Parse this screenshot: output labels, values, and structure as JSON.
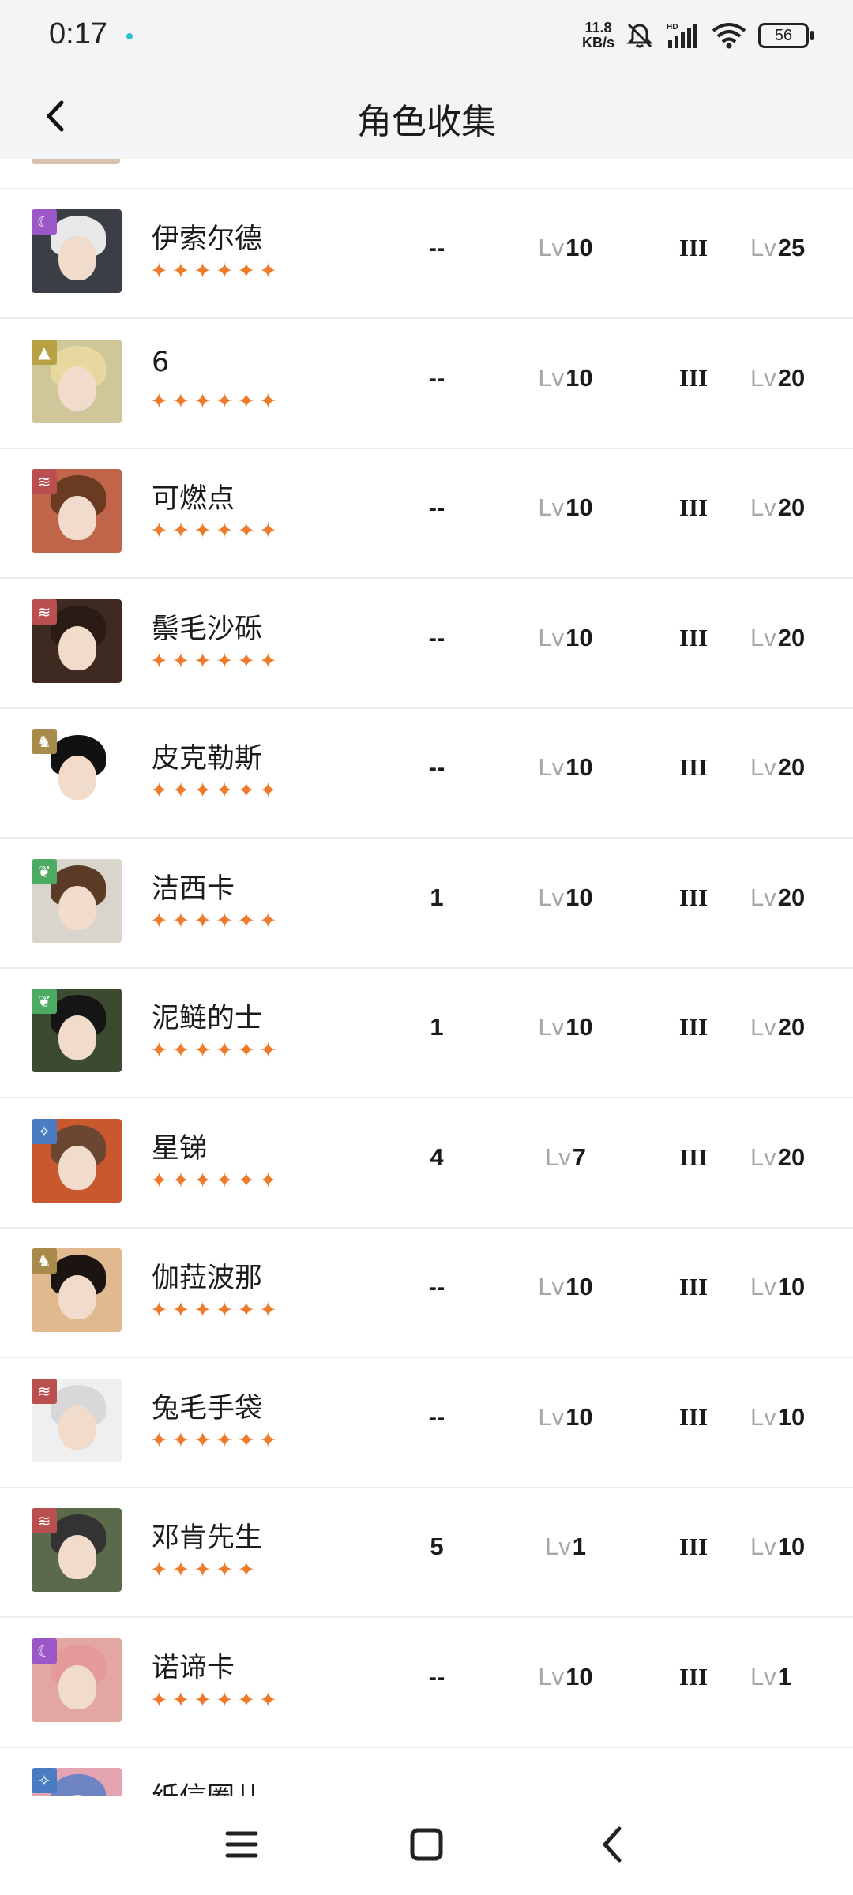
{
  "status": {
    "time": "0:17",
    "net_speed_value": "11.8",
    "net_speed_unit": "KB/s",
    "battery": "56",
    "icons": [
      "bell-muted-icon",
      "hd-signal-icon",
      "wifi-icon",
      "battery-icon"
    ]
  },
  "header": {
    "title": "角色收集"
  },
  "colors": {
    "star": "#ee7b2b",
    "divider": "#ececec",
    "lv_label": "#a7a7a7"
  },
  "characters": [
    {
      "name": "伊索尔德",
      "element": "moon",
      "element_color": "#9b57c7",
      "stars": "✦✦✦✦✦✦",
      "col_a": "--",
      "lv_label": "Lv",
      "level": "10",
      "rank": "III",
      "lv_label2": "Lv",
      "level2": "25",
      "avatar_bg": "#3b3f45",
      "hair": "#e8e8e8"
    },
    {
      "name": "6",
      "element": "mountain",
      "element_color": "#b7a243",
      "stars": "✦✦✦✦✦✦",
      "col_a": "--",
      "lv_label": "Lv",
      "level": "10",
      "rank": "III",
      "lv_label2": "Lv",
      "level2": "20",
      "avatar_bg": "#cfc79a",
      "hair": "#e6d89e"
    },
    {
      "name": "可燃点",
      "element": "wind",
      "element_color": "#b94f4f",
      "stars": "✦✦✦✦✦✦",
      "col_a": "--",
      "lv_label": "Lv",
      "level": "10",
      "rank": "III",
      "lv_label2": "Lv",
      "level2": "20",
      "avatar_bg": "#c0654a",
      "hair": "#6b3a22"
    },
    {
      "name": "鬃毛沙砾",
      "element": "wind",
      "element_color": "#b94f4f",
      "stars": "✦✦✦✦✦✦",
      "col_a": "--",
      "lv_label": "Lv",
      "level": "10",
      "rank": "III",
      "lv_label2": "Lv",
      "level2": "20",
      "avatar_bg": "#3e2a20",
      "hair": "#2a1c14"
    },
    {
      "name": "皮克勒斯",
      "element": "beast",
      "element_color": "#a88a4a",
      "stars": "✦✦✦✦✦✦",
      "col_a": "--",
      "lv_label": "Lv",
      "level": "10",
      "rank": "III",
      "lv_label2": "Lv",
      "level2": "20",
      "avatar_bg": "#ffffff",
      "hair": "#111111"
    },
    {
      "name": "洁西卡",
      "element": "plant",
      "element_color": "#4caa62",
      "stars": "✦✦✦✦✦✦",
      "col_a": "1",
      "lv_label": "Lv",
      "level": "10",
      "rank": "III",
      "lv_label2": "Lv",
      "level2": "20",
      "avatar_bg": "#d9d4cc",
      "hair": "#5a3c26"
    },
    {
      "name": "泥鲢的士",
      "element": "plant",
      "element_color": "#4caa62",
      "stars": "✦✦✦✦✦✦",
      "col_a": "1",
      "lv_label": "Lv",
      "level": "10",
      "rank": "III",
      "lv_label2": "Lv",
      "level2": "20",
      "avatar_bg": "#3d4a32",
      "hair": "#151515"
    },
    {
      "name": "星锑",
      "element": "star",
      "element_color": "#4a7cc4",
      "stars": "✦✦✦✦✦✦",
      "col_a": "4",
      "lv_label": "Lv",
      "level": "7",
      "rank": "III",
      "lv_label2": "Lv",
      "level2": "20",
      "avatar_bg": "#c9582e",
      "hair": "#6b4630"
    },
    {
      "name": "伽菈波那",
      "element": "beast",
      "element_color": "#a88a4a",
      "stars": "✦✦✦✦✦✦",
      "col_a": "--",
      "lv_label": "Lv",
      "level": "10",
      "rank": "III",
      "lv_label2": "Lv",
      "level2": "10",
      "avatar_bg": "#e0b98f",
      "hair": "#1c1410"
    },
    {
      "name": "兔毛手袋",
      "element": "wind",
      "element_color": "#b94f4f",
      "stars": "✦✦✦✦✦✦",
      "col_a": "--",
      "lv_label": "Lv",
      "level": "10",
      "rank": "III",
      "lv_label2": "Lv",
      "level2": "10",
      "avatar_bg": "#efefef",
      "hair": "#d8d8d8"
    },
    {
      "name": "邓肯先生",
      "element": "wind",
      "element_color": "#b94f4f",
      "stars": "✦✦✦✦✦",
      "col_a": "5",
      "lv_label": "Lv",
      "level": "1",
      "rank": "III",
      "lv_label2": "Lv",
      "level2": "10",
      "avatar_bg": "#5a6a4a",
      "hair": "#333333"
    },
    {
      "name": "诺谛卡",
      "element": "moon",
      "element_color": "#9b57c7",
      "stars": "✦✦✦✦✦✦",
      "col_a": "--",
      "lv_label": "Lv",
      "level": "10",
      "rank": "III",
      "lv_label2": "Lv",
      "level2": "1",
      "avatar_bg": "#e2a7a0",
      "hair": "#e59a9a"
    },
    {
      "name": "纸信圈儿",
      "element": "star",
      "element_color": "#4a7cc4",
      "stars": "",
      "col_a": "",
      "lv_label": "",
      "level": "",
      "rank": "",
      "lv_label2": "",
      "level2": "",
      "avatar_bg": "#e3a3b0",
      "hair": "#6c83c4"
    }
  ],
  "nav": {
    "icons": [
      "menu-icon",
      "home-square-icon",
      "back-chevron-icon"
    ]
  }
}
